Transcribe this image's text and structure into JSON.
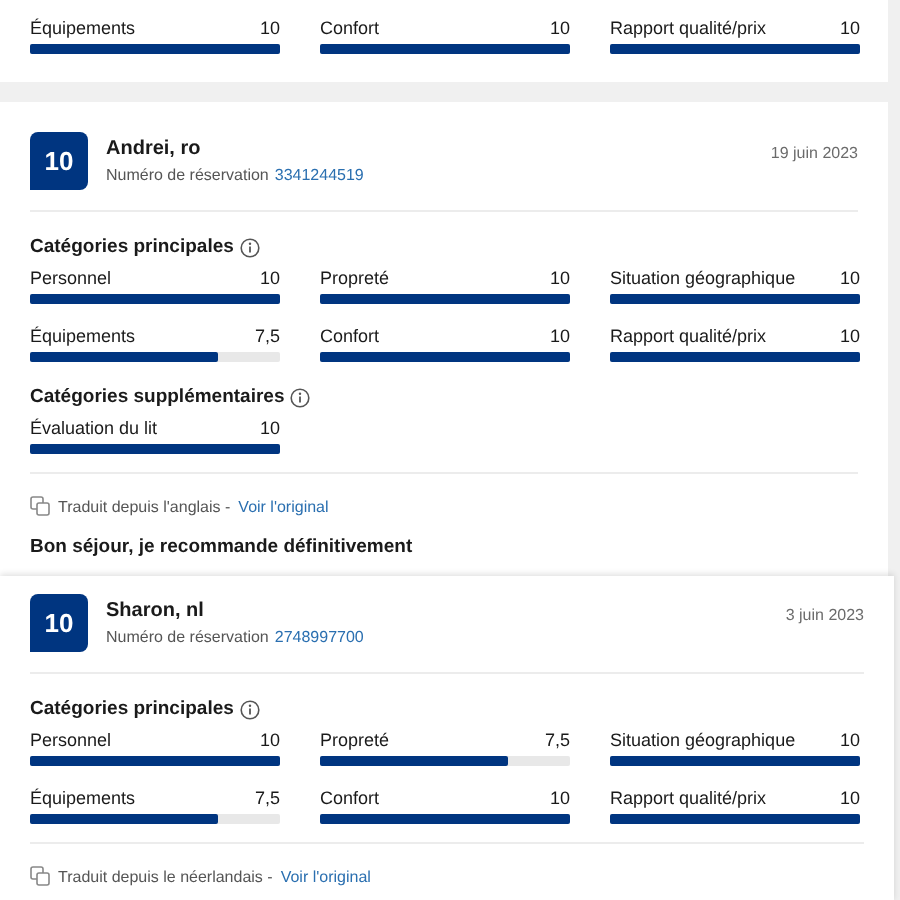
{
  "reviews": [
    {
      "sections": [
        {
          "categories": [
            {
              "label": "Équipements",
              "value": "10",
              "level": 1
            },
            {
              "label": "Confort",
              "value": "10",
              "level": 1
            },
            {
              "label": "Rapport qualité/prix",
              "value": "10",
              "level": 1
            }
          ]
        }
      ]
    },
    {
      "score": "10",
      "name": "Andrei, ro",
      "reservation_label": "Numéro de réservation",
      "reservation_number": "3341244519",
      "date": "19 juin 2023",
      "sections": [
        {
          "title": "Catégories principales",
          "categories": [
            {
              "label": "Personnel",
              "value": "10",
              "level": 1
            },
            {
              "label": "Propreté",
              "value": "10",
              "level": 1
            },
            {
              "label": "Situation géographique",
              "value": "10",
              "level": 1
            },
            {
              "label": "Équipements",
              "value": "7,5",
              "level": 0.75
            },
            {
              "label": "Confort",
              "value": "10",
              "level": 1
            },
            {
              "label": "Rapport qualité/prix",
              "value": "10",
              "level": 1
            }
          ]
        },
        {
          "title": "Catégories supplémentaires",
          "categories": [
            {
              "label": "Évaluation du lit",
              "value": "10",
              "level": 1
            }
          ]
        }
      ],
      "translation": {
        "text": "Traduit depuis l'anglais -",
        "link": "Voir l'original"
      },
      "review_title": "Bon séjour, je recommande définitivement"
    },
    {
      "score": "10",
      "name": "Sharon, nl",
      "reservation_label": "Numéro de réservation",
      "reservation_number": "2748997700",
      "date": "3 juin 2023",
      "sections": [
        {
          "title": "Catégories principales",
          "categories": [
            {
              "label": "Personnel",
              "value": "10",
              "level": 1
            },
            {
              "label": "Propreté",
              "value": "7,5",
              "level": 0.75
            },
            {
              "label": "Situation géographique",
              "value": "10",
              "level": 1
            },
            {
              "label": "Équipements",
              "value": "7,5",
              "level": 0.75
            },
            {
              "label": "Confort",
              "value": "10",
              "level": 1
            },
            {
              "label": "Rapport qualité/prix",
              "value": "10",
              "level": 1
            }
          ]
        }
      ],
      "translation": {
        "text": "Traduit depuis le néerlandais -",
        "link": "Voir l'original"
      }
    }
  ]
}
